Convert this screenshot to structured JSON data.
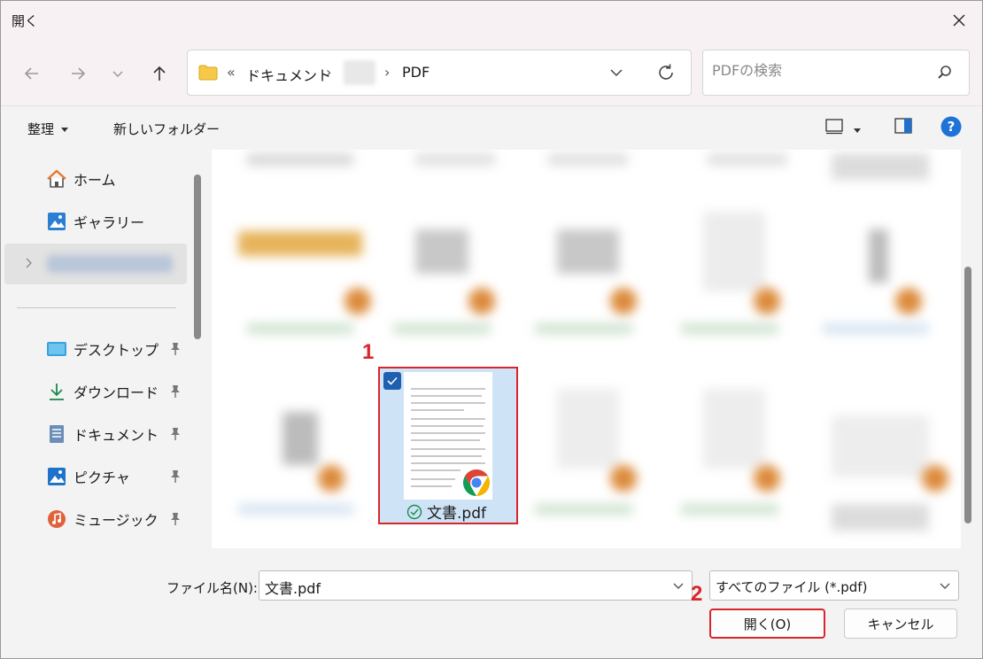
{
  "window": {
    "title": "開く"
  },
  "address": {
    "overflow": "«",
    "segments": [
      "ドキュメント",
      "PDF"
    ],
    "separator": "›"
  },
  "search": {
    "placeholder": "PDFの検索"
  },
  "toolbar": {
    "organize": "整理",
    "new_folder": "新しいフォルダー"
  },
  "sidebar": {
    "items": [
      {
        "label": "ホーム",
        "icon": "home-icon"
      },
      {
        "label": "ギャラリー",
        "icon": "gallery-icon"
      },
      {
        "label": "デスクトップ",
        "icon": "desktop-icon"
      },
      {
        "label": "ダウンロード",
        "icon": "download-icon"
      },
      {
        "label": "ドキュメント",
        "icon": "document-icon"
      },
      {
        "label": "ピクチャ",
        "icon": "pictures-icon"
      },
      {
        "label": "ミュージック",
        "icon": "music-icon"
      }
    ]
  },
  "files": {
    "selected_name": "文書.pdf"
  },
  "annotations": {
    "step1": "1",
    "step2": "2"
  },
  "footer": {
    "filename_label": "ファイル名(N):",
    "filename_value": "文書.pdf",
    "filetype_value": "すべてのファイル (*.pdf)",
    "open_label": "開く(O)",
    "cancel_label": "キャンセル"
  },
  "colors": {
    "accent": "#1f5fb0",
    "highlight": "#d8262b",
    "selection": "#cfe3f7"
  }
}
